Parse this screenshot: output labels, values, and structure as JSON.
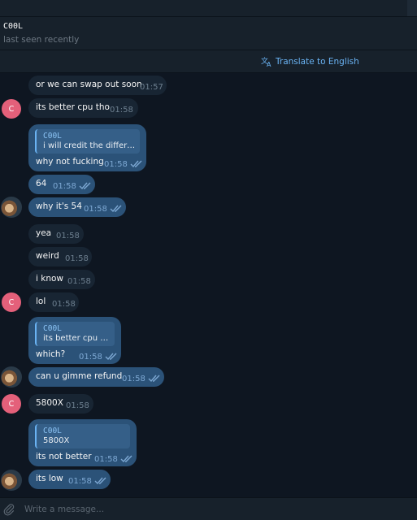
{
  "header": {
    "name": "C00L",
    "status": "last seen recently"
  },
  "translate": {
    "label": "Translate to English",
    "icon": "translate-icon",
    "color": "#6ab3f3"
  },
  "colors": {
    "background": "#0e1621",
    "incoming_bubble": "#182533",
    "outgoing_bubble": "#2b5278",
    "avatar_letter_bg": "#e4607a"
  },
  "messages": [
    {
      "dir": "in",
      "text": "or we can swap out soon",
      "time": "01:57",
      "avatar": null
    },
    {
      "dir": "in",
      "text": "its better cpu tho",
      "time": "01:58",
      "avatar": "C"
    },
    {
      "dir": "out",
      "reply_name": "C00L",
      "reply_text": "i will credit the differe...",
      "text": "why not fucking",
      "time": "01:58",
      "read": true
    },
    {
      "dir": "out",
      "text": "64",
      "time": "01:58",
      "read": true
    },
    {
      "dir": "out",
      "text": "why it's 54",
      "time": "01:58",
      "read": true,
      "avatar": "photo"
    },
    {
      "dir": "in",
      "text": "yea",
      "time": "01:58"
    },
    {
      "dir": "in",
      "text": "weird",
      "time": "01:58"
    },
    {
      "dir": "in",
      "text": "i know",
      "time": "01:58"
    },
    {
      "dir": "in",
      "text": "lol",
      "time": "01:58",
      "avatar": "C"
    },
    {
      "dir": "out",
      "reply_name": "C00L",
      "reply_text": "its better cpu tho",
      "text": "which?",
      "time": "01:58",
      "read": true
    },
    {
      "dir": "out",
      "text": "can u gimme refund",
      "time": "01:58",
      "read": true,
      "avatar": "photo"
    },
    {
      "dir": "in",
      "text": "5800X",
      "time": "01:58",
      "avatar": "C"
    },
    {
      "dir": "out",
      "reply_name": "C00L",
      "reply_text": "5800X",
      "text": "its not better",
      "time": "01:58",
      "read": true
    },
    {
      "dir": "out",
      "text": "its low",
      "time": "01:58",
      "read": true,
      "avatar": "photo"
    }
  ],
  "avatar_letter": "C",
  "composer": {
    "placeholder": "Write a message..."
  }
}
